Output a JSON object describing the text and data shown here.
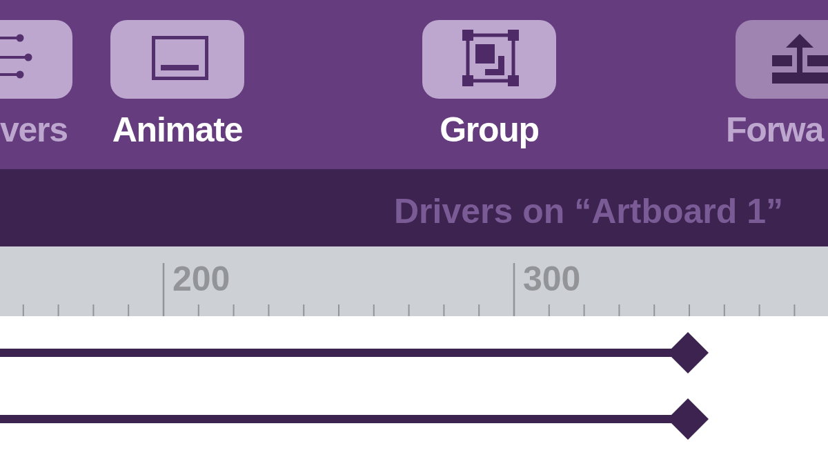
{
  "toolbar": {
    "tools": [
      {
        "label": "vers",
        "highlighted": false,
        "disabled": false
      },
      {
        "label": "Animate",
        "highlighted": true,
        "disabled": false
      },
      {
        "label": "Group",
        "highlighted": true,
        "disabled": false
      },
      {
        "label": "Forwa",
        "highlighted": false,
        "disabled": true
      }
    ]
  },
  "drivers_header": {
    "title": "Drivers on “Artboard 1”"
  },
  "ruler": {
    "labels": [
      "200",
      "300"
    ]
  },
  "timeline": {
    "tracks": [
      {
        "keyframe": true
      },
      {
        "keyframe": true
      }
    ]
  }
}
